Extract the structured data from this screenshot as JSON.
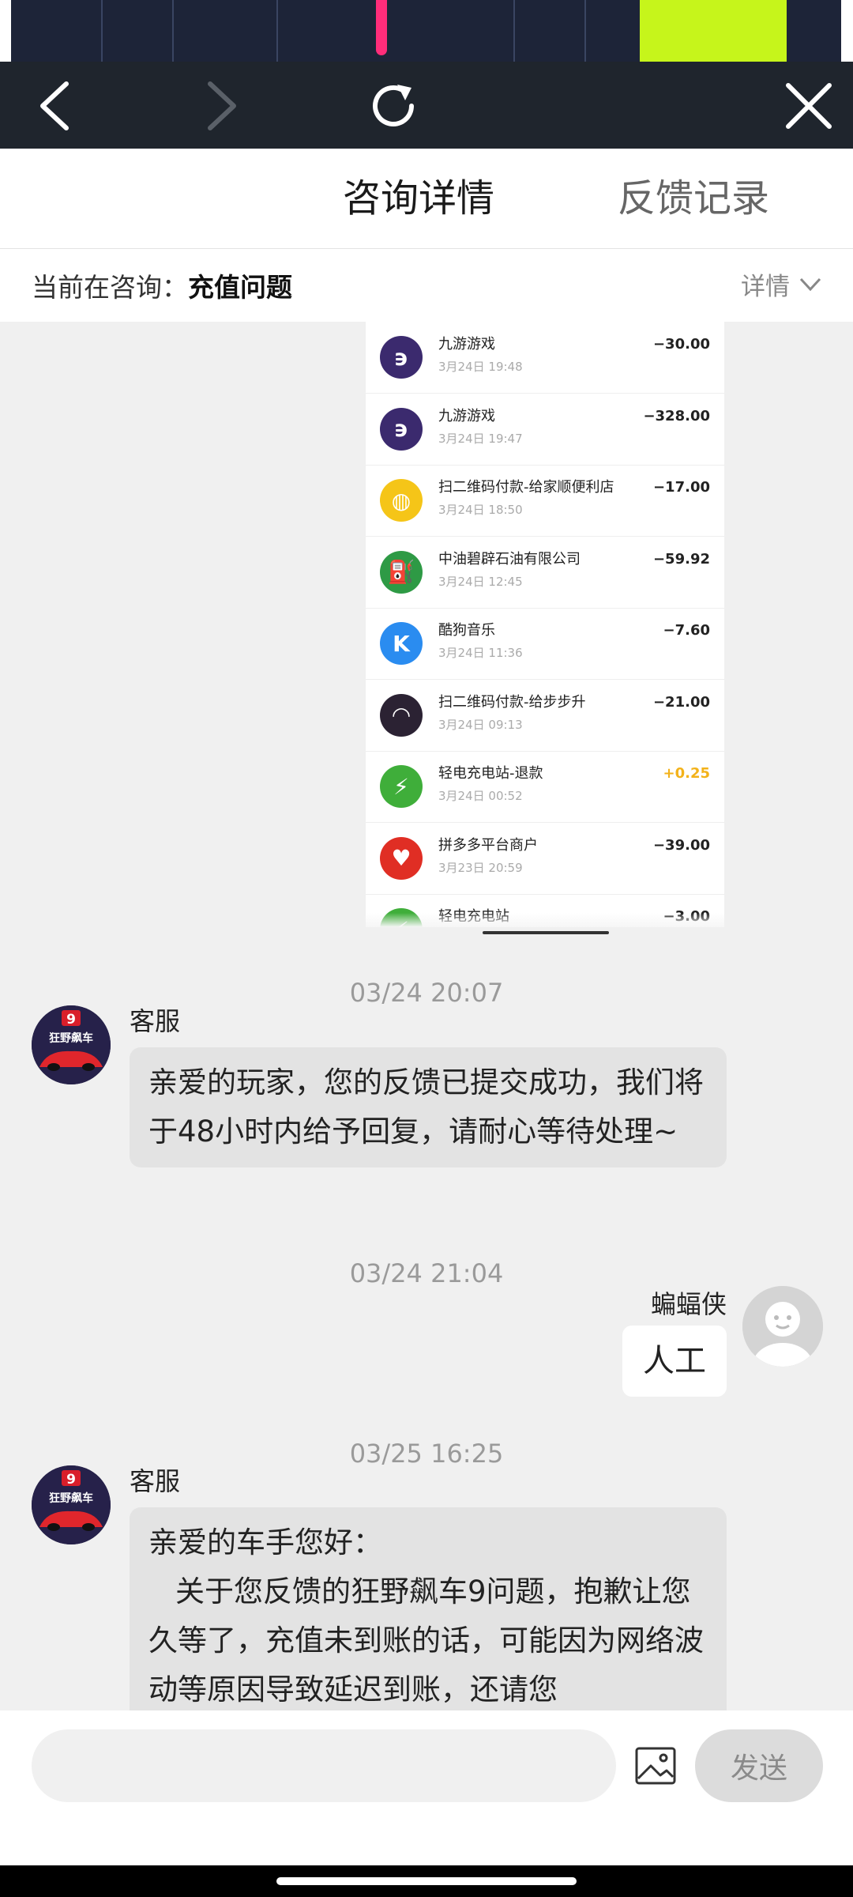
{
  "header": {
    "tab_active": "咨询详情",
    "tab_inactive": "反馈记录"
  },
  "subheader": {
    "prefix": "当前在咨询：",
    "topic": "充值问题",
    "detail_label": "详情"
  },
  "transactions": [
    {
      "name": "九游游戏",
      "time": "3月24日 19:48",
      "amount": "−30.00",
      "icon": "nine-game-icon",
      "color": "#3b2a6e",
      "positive": false
    },
    {
      "name": "九游游戏",
      "time": "3月24日 19:47",
      "amount": "−328.00",
      "icon": "nine-game-icon",
      "color": "#3b2a6e",
      "positive": false
    },
    {
      "name": "扫二维码付款-给家顺便利店",
      "time": "3月24日 18:50",
      "amount": "−17.00",
      "icon": "money-bag-icon",
      "color": "#f5c518",
      "positive": false
    },
    {
      "name": "中油碧辟石油有限公司",
      "time": "3月24日 12:45",
      "amount": "−59.92",
      "icon": "fuel-station-icon",
      "color": "#2e9a45",
      "positive": false
    },
    {
      "name": "酷狗音乐",
      "time": "3月24日 11:36",
      "amount": "−7.60",
      "icon": "kugou-icon",
      "color": "#2a8cf0",
      "positive": false
    },
    {
      "name": "扫二维码付款-给步步升",
      "time": "3月24日 09:13",
      "amount": "−21.00",
      "icon": "sunset-avatar-icon",
      "color": "#2b2233",
      "positive": false
    },
    {
      "name": "轻电充电站-退款",
      "time": "3月24日 00:52",
      "amount": "+0.25",
      "icon": "ev-charge-icon",
      "color": "#3fae3a",
      "positive": true
    },
    {
      "name": "拼多多平台商户",
      "time": "3月23日 20:59",
      "amount": "−39.00",
      "icon": "pinduoduo-icon",
      "color": "#e02e24",
      "positive": false
    },
    {
      "name": "轻电充电站",
      "time": "",
      "amount": "−3.00",
      "icon": "ev-charge-icon",
      "color": "#3fae3a",
      "positive": false
    }
  ],
  "messages": [
    {
      "timestamp": "03/24 20:07",
      "sender": "客服",
      "text": "亲爱的玩家，您的反馈已提交成功，我们将于48小时内给予回复，请耐心等待处理~"
    },
    {
      "timestamp": "03/24 21:04",
      "sender": "蝙蝠侠",
      "text": "人工"
    },
    {
      "timestamp": "03/25 16:25",
      "sender": "客服",
      "text_line1": "亲爱的车手您好：",
      "text_line2": "关于您反馈的狂野飙车9问题，抱歉让您久等了，充值未到账的话，可能因为网络波动等原因导致延迟到账，还请您"
    }
  ],
  "avatar_game_badge": "9",
  "avatar_game_caption": "狂野飙车",
  "input": {
    "placeholder": "",
    "send_label": "发送"
  },
  "colors": {
    "toolbar": "#1f252d",
    "bubble_left": "#e3e3e3",
    "bubble_right": "#ffffff",
    "refund_amount": "#f3b21a"
  }
}
